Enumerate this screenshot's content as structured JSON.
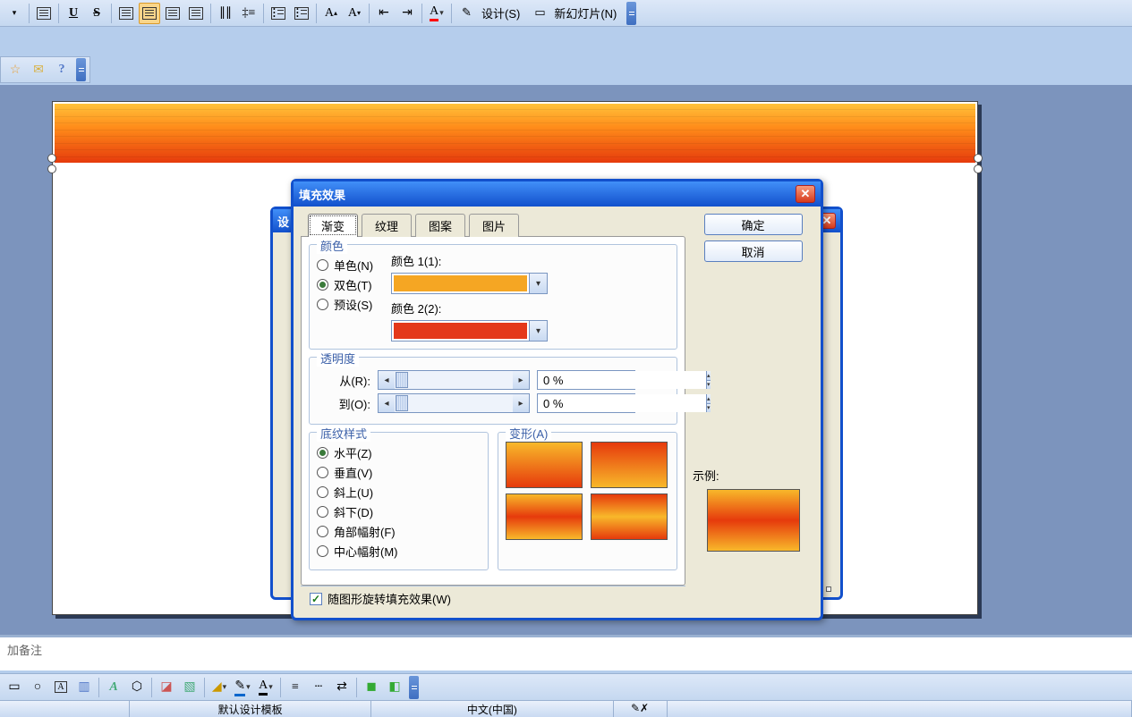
{
  "toolbar": {
    "buttons": {
      "underline": "U",
      "strike": "S",
      "design_label": "设计(S)",
      "new_slide_label": "新幻灯片(N)"
    }
  },
  "float_toolbar": {
    "help": "?"
  },
  "notes": {
    "placeholder": "加备注"
  },
  "status": {
    "template": "默认设计模板",
    "lang": "中文(中国)"
  },
  "behind_dialog": {
    "title": "设"
  },
  "dialog": {
    "title": "填充效果",
    "tabs": {
      "gradient": "渐变",
      "texture": "纹理",
      "pattern": "图案",
      "picture": "图片"
    },
    "ok": "确定",
    "cancel": "取消",
    "color_group": {
      "label": "颜色",
      "opt_one": "单色(N)",
      "opt_two": "双色(T)",
      "opt_preset": "预设(S)",
      "color1_label": "颜色 1(1):",
      "color2_label": "颜色 2(2):",
      "color1": "#F5A623",
      "color2": "#E4381A"
    },
    "transparency": {
      "label": "透明度",
      "from_label": "从(R):",
      "to_label": "到(O):",
      "from_value": "0 %",
      "to_value": "0 %"
    },
    "shading": {
      "label": "底纹样式",
      "horizontal": "水平(Z)",
      "vertical": "垂直(V)",
      "diag_up": "斜上(U)",
      "diag_down": "斜下(D)",
      "from_corner": "角部幅射(F)",
      "from_center": "中心幅射(M)"
    },
    "variants": {
      "label": "变形(A)"
    },
    "sample_label": "示例:",
    "rotate_checkbox": "随图形旋转填充效果(W)"
  }
}
